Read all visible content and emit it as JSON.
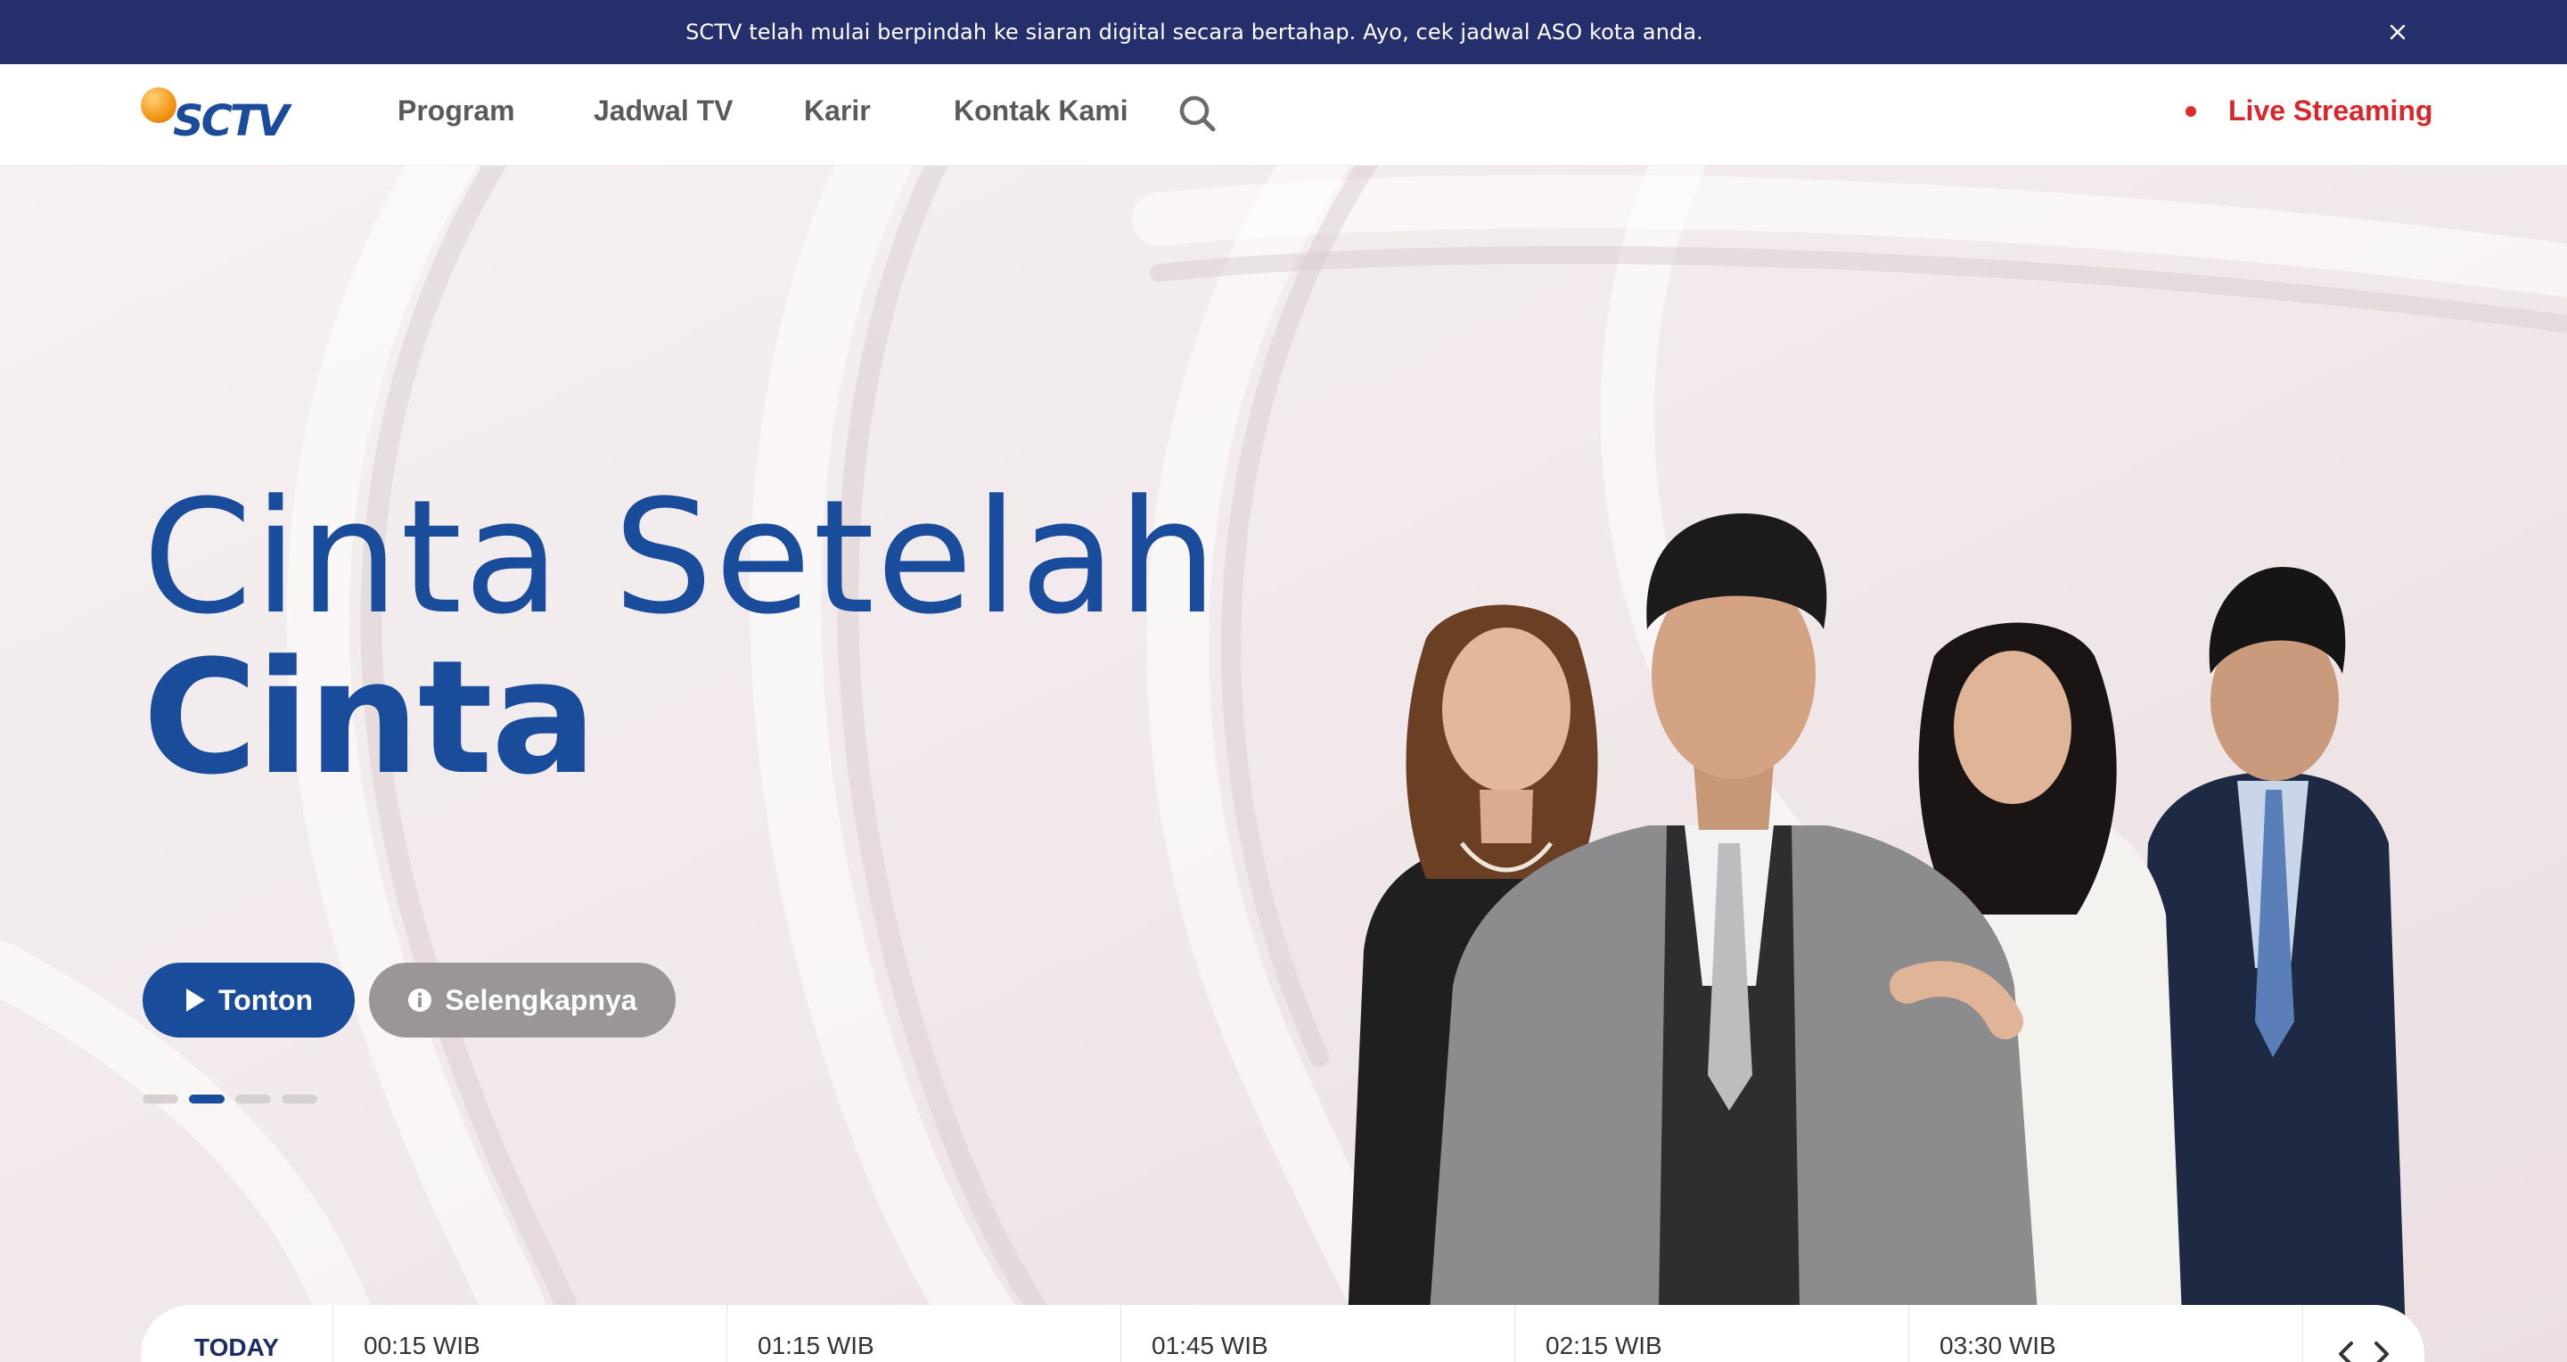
{
  "announcement": {
    "text": "SCTV telah mulai berpindah ke siaran digital secara bertahap. Ayo, cek jadwal ASO kota anda.",
    "close_icon": "close-icon"
  },
  "header": {
    "logo_text": "SCTV",
    "nav": [
      "Program",
      "Jadwal TV",
      "Karir",
      "Kontak Kami"
    ],
    "search_icon": "search-icon",
    "live_label": "Live Streaming"
  },
  "hero": {
    "title_line1": "Cinta Setelah",
    "title_line2": "Cinta",
    "watch_label": "Tonton",
    "more_label": "Selengkapnya",
    "slides_total": 4,
    "active_slide": 2
  },
  "schedule": {
    "today_label": "TODAY",
    "slots": [
      "00:15 WIB",
      "01:15 WIB",
      "01:45 WIB",
      "02:15 WIB",
      "03:30 WIB"
    ]
  },
  "colors": {
    "announcement_bg": "#252f6b",
    "brand_blue": "#1a4c9c",
    "live_red": "#d9262b",
    "secondary_button": "#9a9596"
  }
}
